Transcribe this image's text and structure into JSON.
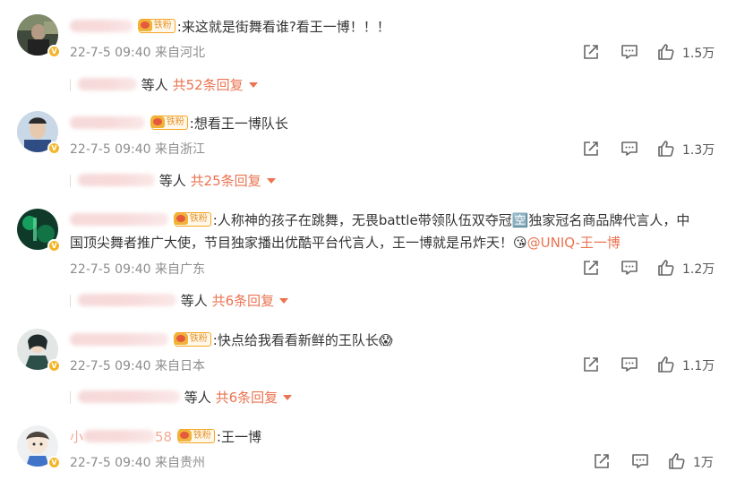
{
  "badge_label": "铁粉",
  "meta_sep": " ",
  "reply_sep": " ",
  "comments": [
    {
      "text": ":来这就是街舞看谁?看王一博！！！",
      "time": "22-7-5 09:40",
      "location": "来自河北",
      "likes": "1.5万",
      "reply_suffix": "等人",
      "reply_count": "共52条回复"
    },
    {
      "text": ":想看王一博队长",
      "time": "22-7-5 09:40",
      "location": "来自浙江",
      "likes": "1.3万",
      "reply_suffix": "等人",
      "reply_count": "共25条回复"
    },
    {
      "text_line1": ":人称神的孩子在跳舞，无畏battle带领队伍双夺冠🈳独家冠名商品牌代言人，中",
      "text_line2": "国顶尖舞者推广大使，节目独家播出优酷平台代言人，王一博就是吊炸天！",
      "emoji": "😘",
      "mention": "@UNIQ-王一博",
      "time": "22-7-5 09:40",
      "location": "来自广东",
      "likes": "1.2万",
      "reply_suffix": "等人",
      "reply_count": "共6条回复"
    },
    {
      "text": ":快点给我看看新鲜的王队长",
      "emoji": "😱",
      "time": "22-7-5 09:40",
      "location": "来自日本",
      "likes": "1.1万",
      "reply_suffix": "等人",
      "reply_count": "共6条回复"
    },
    {
      "name_partial": "小",
      "name_tail": "58",
      "text": ":王一博",
      "time": "22-7-5 09:40",
      "location": "来自贵州",
      "likes": "1万"
    }
  ],
  "colors": {
    "accent": "#eb7350",
    "meta": "#8c8c8c",
    "badge_border": "#f5a623"
  },
  "icons": [
    "share-icon",
    "comment-icon",
    "like-icon",
    "fan-crown-icon",
    "caret-down-icon"
  ]
}
